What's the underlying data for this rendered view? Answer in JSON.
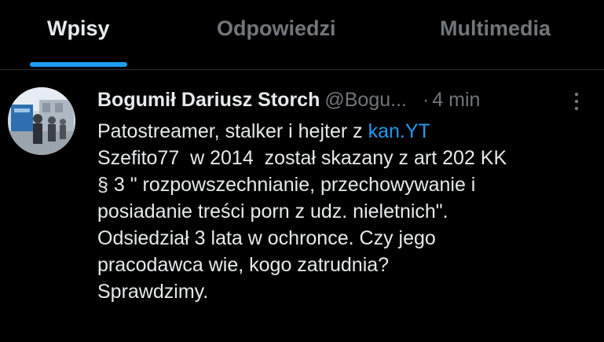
{
  "tabs": [
    {
      "label": "Wpisy",
      "active": true
    },
    {
      "label": "Odpowiedzi",
      "active": false
    },
    {
      "label": "Multimedia",
      "active": false
    }
  ],
  "post": {
    "author_name": "Bogumił Dariusz Storch",
    "handle": "@Bogu...",
    "dot": "·",
    "time": "4 min",
    "lines": {
      "l1_text": "Patostreamer, stalker i hejter z ",
      "l1_link": "kan.YT",
      "l2": "Szefito77  w 2014  został skazany z art 202 KK",
      "l3": "§ 3 \" rozpowszechnianie, przechowywanie i",
      "l4": "posiadanie treści porn z udz. nieletnich\".",
      "l5": "Odsiedział 3 lata w ochronce. Czy jego",
      "l6": "pracodawca wie, kogo zatrudnia?",
      "l7": "Sprawdzimy."
    }
  },
  "colors": {
    "background": "#000000",
    "text_primary": "#e7e9ea",
    "text_secondary": "#71767b",
    "accent": "#1d9bf0"
  },
  "icons": {
    "more": "more-vertical-icon",
    "avatar": "avatar-photo"
  }
}
